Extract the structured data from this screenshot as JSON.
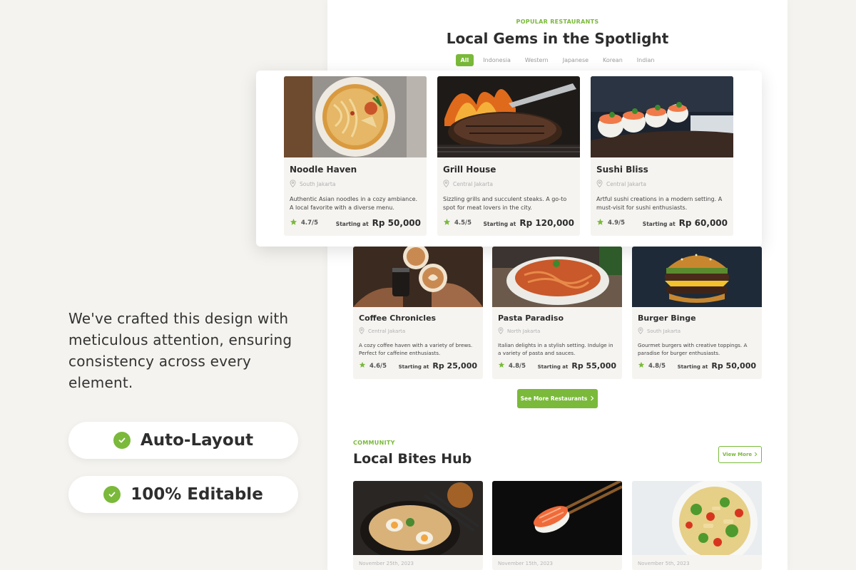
{
  "promo": {
    "text": "We've crafted this design with meticulous attention, ensuring consistency across every element.",
    "badges": [
      "Auto-Layout",
      "100% Editable"
    ]
  },
  "colors": {
    "accent": "#7ab93a",
    "star": "#7ab93a"
  },
  "popular": {
    "eyebrow": "POPULAR RESTAURANTS",
    "title": "Local Gems in the Spotlight",
    "tabs": [
      "All",
      "Indonesia",
      "Western",
      "Japanese",
      "Korean",
      "Indian"
    ],
    "active_tab": "All"
  },
  "featured": [
    {
      "name": "Noodle Haven",
      "location": "South Jakarta",
      "description": "Authentic Asian noodles in a cozy ambiance. A local favorite with a diverse menu.",
      "rating": "4.7/5",
      "price_label": "Starting at",
      "price": "Rp 50,000",
      "image": "noodle-soup-photo"
    },
    {
      "name": "Grill House",
      "location": "Central Jakarta",
      "description": "Sizzling grills and succulent steaks. A go-to spot for meat lovers in the city.",
      "rating": "4.5/5",
      "price_label": "Starting at",
      "price": "Rp 120,000",
      "image": "grilled-steak-photo"
    },
    {
      "name": "Sushi Bliss",
      "location": "Central Jakarta",
      "description": "Artful sushi creations in a modern setting. A must-visit for sushi enthusiasts.",
      "rating": "4.9/5",
      "price_label": "Starting at",
      "price": "Rp 60,000",
      "image": "sushi-rolls-photo"
    }
  ],
  "restaurants": [
    {
      "name": "Coffee Chronicles",
      "location": "Central Jakarta",
      "description": "A cozy coffee haven with a variety of brews. Perfect for caffeine enthusiasts.",
      "rating": "4.6/5",
      "price_label": "Starting at",
      "price": "Rp 25,000",
      "image": "latte-art-photo"
    },
    {
      "name": "Pasta Paradiso",
      "location": "North Jakarta",
      "description": "Italian delights in a stylish setting. Indulge in a variety of pasta and sauces.",
      "rating": "4.8/5",
      "price_label": "Starting at",
      "price": "Rp 55,000",
      "image": "spaghetti-photo"
    },
    {
      "name": "Burger Binge",
      "location": "South Jakarta",
      "description": "Gourmet burgers with creative toppings. A paradise for burger enthusiasts.",
      "rating": "4.8/5",
      "price_label": "Starting at",
      "price": "Rp 50,000",
      "image": "burger-photo"
    }
  ],
  "see_more_label": "See More Restaurants",
  "community": {
    "eyebrow": "COMMUNITY",
    "title": "Local Bites Hub",
    "view_more_label": "View More",
    "posts": [
      {
        "date": "November 25th, 2023",
        "image": "ramen-bowl-photo"
      },
      {
        "date": "November 15th, 2023",
        "image": "sushi-chopsticks-photo"
      },
      {
        "date": "November 5th, 2023",
        "image": "pasta-salad-photo"
      }
    ]
  }
}
